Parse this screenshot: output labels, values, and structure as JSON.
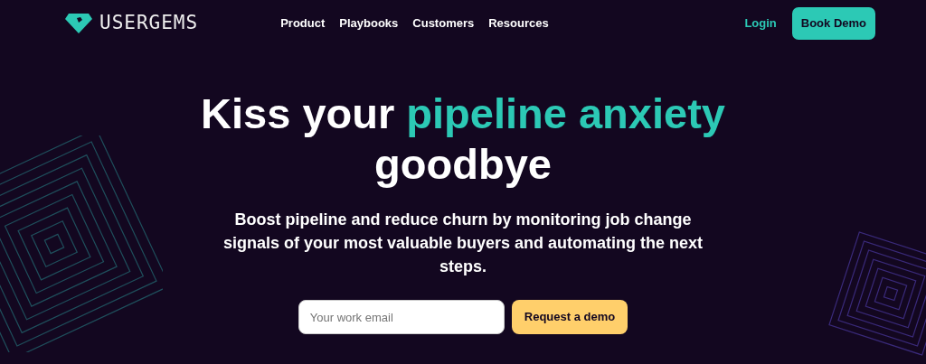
{
  "brand": {
    "name": "USERGEMS"
  },
  "nav": {
    "links": [
      {
        "label": "Product"
      },
      {
        "label": "Playbooks"
      },
      {
        "label": "Customers"
      },
      {
        "label": "Resources"
      }
    ],
    "login": "Login",
    "cta": "Book Demo"
  },
  "hero": {
    "headline": [
      {
        "text": "Kiss your ",
        "accent": false
      },
      {
        "text": "pipeline anxiety",
        "accent": true
      },
      {
        "text": "goodbye",
        "accent": false,
        "new_line": true
      }
    ],
    "subtitle": "Boost pipeline and reduce churn by monitoring job change signals of your most valuable buyers and automating the next steps.",
    "email": {
      "placeholder": "Your work email"
    },
    "button": "Request a demo"
  }
}
